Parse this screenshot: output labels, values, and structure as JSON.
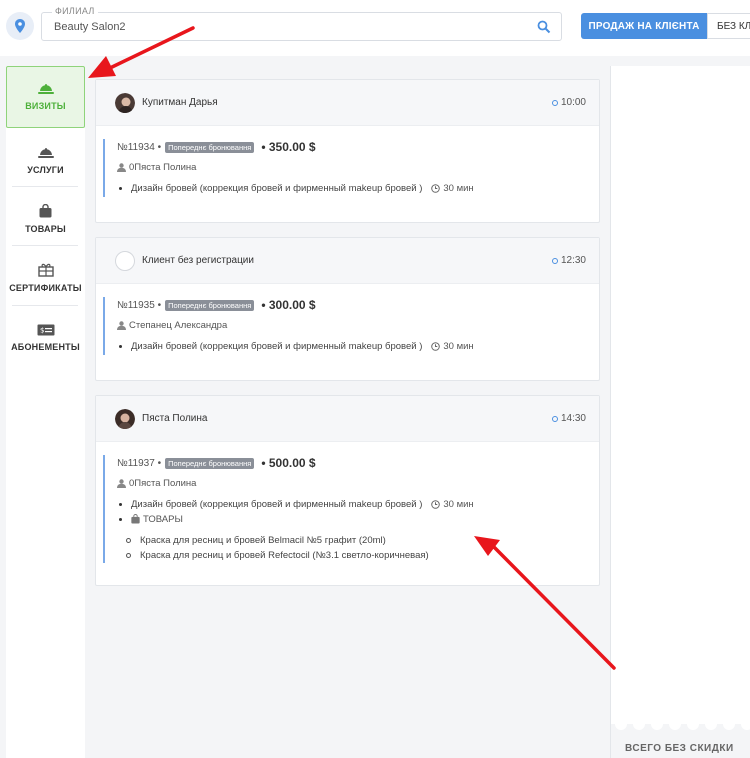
{
  "header": {
    "branch_label": "ФИЛИАЛ",
    "branch_value": "Beauty Salon2",
    "sale_button": "ПРОДАЖ НА КЛІЄНТА",
    "nodisc_button": "БЕЗ КЛІЄН"
  },
  "sidebar": {
    "items": [
      {
        "label": "ВИЗИТЫ",
        "icon": "cloche-icon",
        "active": true
      },
      {
        "label": "УСЛУГИ",
        "icon": "cloche-icon"
      },
      {
        "label": "ТОВАРЫ",
        "icon": "bag-icon"
      },
      {
        "label": "СЕРТИФИКАТЫ",
        "icon": "gift-icon"
      },
      {
        "label": "АБОНЕМЕНТЫ",
        "icon": "card-icon"
      }
    ]
  },
  "visits": [
    {
      "client": "Купитман Дарья",
      "time": "10:00",
      "record": "№11934 •",
      "badge": "Попереднє бронювання",
      "price": "• 350.00 $",
      "master": "0Пяста Полина",
      "service": "Дизайн бровей (коррекция бровей и фирменный makeup бровей )",
      "duration": "30 мин"
    },
    {
      "client": "Клиент без регистрации",
      "time": "12:30",
      "record": "№11935 •",
      "badge": "Попереднє бронювання",
      "price": "• 300.00 $",
      "master": "Степанец Александра",
      "service": "Дизайн бровей (коррекция бровей и фирменный makeup бровей )",
      "duration": "30 мин"
    },
    {
      "client": "Пяста Полина",
      "time": "14:30",
      "record": "№11937 •",
      "badge": "Попереднє бронювання",
      "price": "• 500.00 $",
      "master": "0Пяста Полина",
      "service": "Дизайн бровей (коррекция бровей и фирменный makeup бровей )",
      "duration": "30 мин",
      "goods_label": "ТОВАРЫ",
      "goods": [
        "Краска для ресниц и бровей Belmacil №5 графит (20ml)",
        "Краска для ресниц и бровей Refectocil (№3.1 светло-коричневая)"
      ]
    }
  ],
  "right_panel": {
    "total_label": "ВСЕГО БЕЗ СКИДКИ"
  },
  "colors": {
    "accent": "#4a8fe0",
    "active_green": "#4db03a",
    "annotation_red": "#e8161c"
  }
}
